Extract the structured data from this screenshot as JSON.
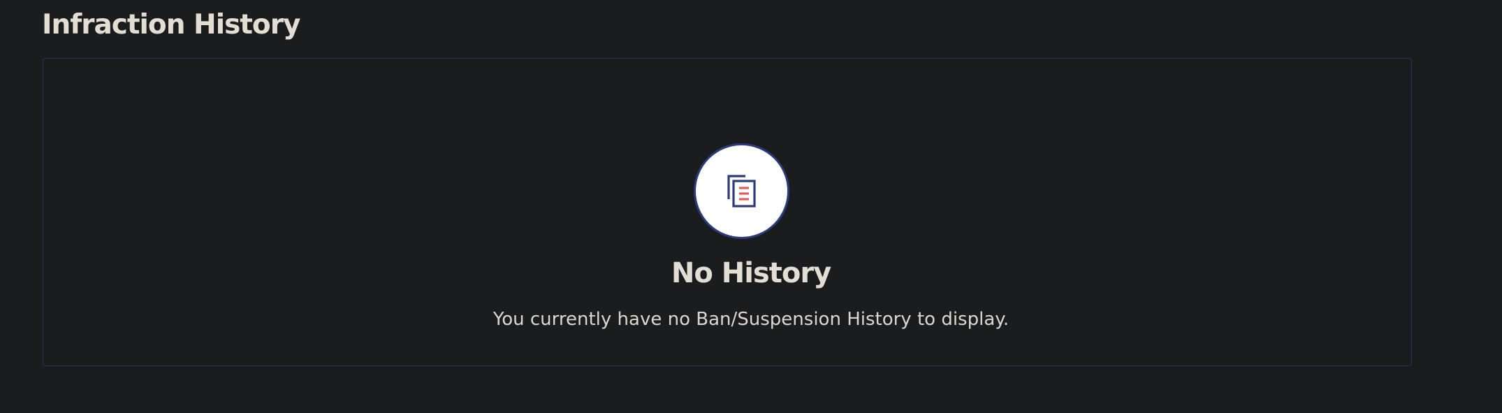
{
  "section": {
    "title": "Infraction History"
  },
  "empty_state": {
    "icon": "documents-icon",
    "title": "No History",
    "message": "You currently have no Ban/Suspension History to display."
  },
  "colors": {
    "background": "#1b1c1e",
    "panel_border": "#2f2f66",
    "text_primary": "#e3ded3",
    "icon_ring": "#2c3b7c",
    "icon_accent": "#e35b5b"
  }
}
